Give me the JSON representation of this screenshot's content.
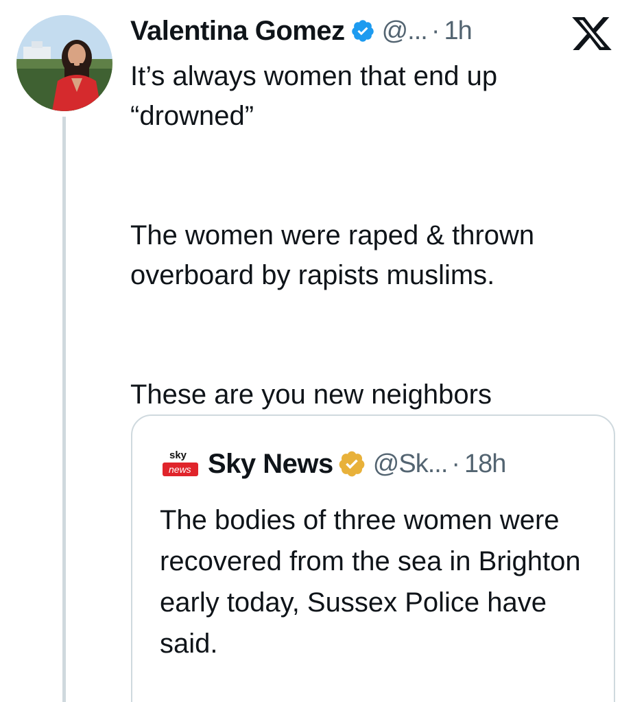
{
  "author": {
    "name": "Valentina Gomez",
    "handle": "@...",
    "separator": "·",
    "time": "1h",
    "verified_color": "#1d9bf0"
  },
  "tweet": {
    "lines": [
      "It’s always women that end up “drowned”",
      "The women were raped & thrown overboard by rapists muslims.",
      "These are you new neighbors"
    ]
  },
  "quoted": {
    "logo_top": "sky",
    "logo_bottom": "news",
    "name": "Sky News",
    "handle": "@Sk...",
    "separator": "·",
    "time": "18h",
    "badge_color": "#e8b13a",
    "text": "The bodies of three women were recovered from the sea in Brighton early today, Sussex Police have said."
  },
  "icons": {
    "platform": "x-logo-icon",
    "verified": "verified-check-icon",
    "org_badge": "gold-verified-icon"
  }
}
